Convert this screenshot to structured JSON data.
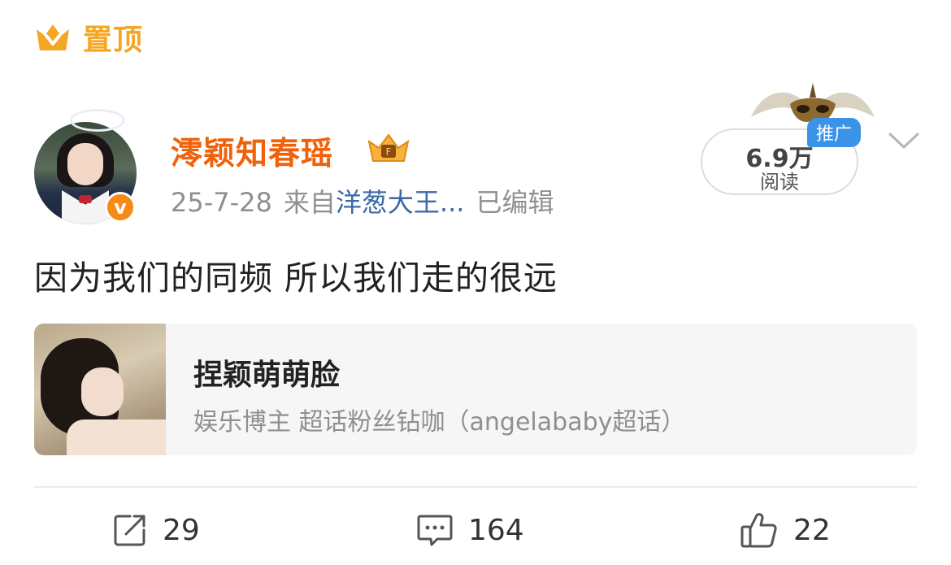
{
  "pin": {
    "icon": "crown-icon",
    "label": "置顶",
    "color": "#f5a623"
  },
  "post": {
    "author": {
      "name": "澪颖知春瑶",
      "verified_badge": "v-badge-icon",
      "member_badge": "crown-member-icon"
    },
    "meta": {
      "date": "25-7-28",
      "from_prefix": "来自",
      "source": "洋葱大王...",
      "edited": "已编辑"
    },
    "reads": {
      "count": "6.9万",
      "label": "阅读",
      "promo_tag": "推广"
    },
    "text": "因为我们的同频 所以我们走的很远"
  },
  "card": {
    "title": "捏颖萌萌脸",
    "subtitle": "娱乐博主 超话粉丝钻咖（angelababy超话）"
  },
  "actions": {
    "repost": "29",
    "comment": "164",
    "like": "22"
  },
  "colors": {
    "accent_orange": "#f0620a",
    "link_blue": "#3a6aa6",
    "tag_blue": "#3b93e8"
  }
}
